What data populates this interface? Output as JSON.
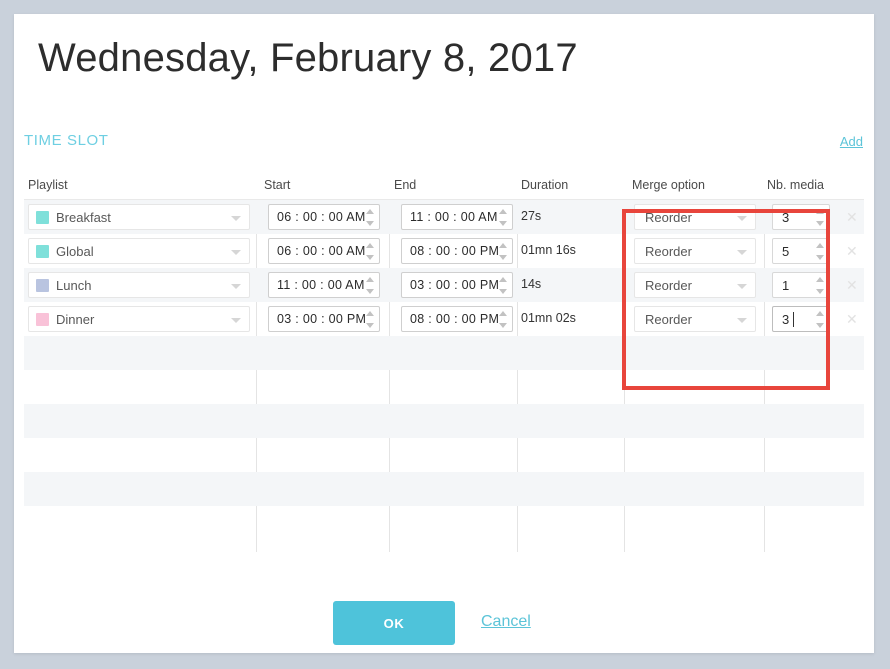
{
  "window": {
    "title": "Wednesday, February 8, 2017"
  },
  "section": {
    "title": "TIME SLOT",
    "add_label": "Add"
  },
  "table": {
    "columns": [
      {
        "key": "playlist",
        "label": "Playlist"
      },
      {
        "key": "start",
        "label": "Start"
      },
      {
        "key": "end",
        "label": "End"
      },
      {
        "key": "duration",
        "label": "Duration"
      },
      {
        "key": "merge_option",
        "label": "Merge option"
      },
      {
        "key": "nb_media",
        "label": "Nb. media"
      }
    ],
    "rows": [
      {
        "playlist": "Breakfast",
        "playlist_color": "#7fe0da",
        "start": "06 : 00 : 00 AM",
        "end": "11 : 00 : 00 AM",
        "duration": "27s",
        "merge_option": "Reorder",
        "nb_media": "3",
        "remove_icon": "close-icon"
      },
      {
        "playlist": "Global",
        "playlist_color": "#7fe0da",
        "start": "06 : 00 : 00 AM",
        "end": "08 : 00 : 00 PM",
        "duration": "01mn 16s",
        "merge_option": "Reorder",
        "nb_media": "5",
        "remove_icon": "close-icon"
      },
      {
        "playlist": "Lunch",
        "playlist_color": "#b9c4e0",
        "start": "11 : 00 : 00 AM",
        "end": "03 : 00 : 00 PM",
        "duration": "14s",
        "merge_option": "Reorder",
        "nb_media": "1",
        "remove_icon": "close-icon"
      },
      {
        "playlist": "Dinner",
        "playlist_color": "#f9c2d8",
        "start": "03 : 00 : 00 PM",
        "end": "08 : 00 : 00 PM",
        "duration": "01mn 02s",
        "merge_option": "Reorder",
        "nb_media": "3",
        "remove_icon": "close-icon",
        "focused": true
      }
    ],
    "empty_row_count": 6
  },
  "highlight": {
    "color": "#e8453c",
    "covers": "Merge option and Nb. media columns"
  },
  "footer": {
    "ok_label": "OK",
    "cancel_label": "Cancel"
  },
  "colors": {
    "accent": "#4ec3da",
    "link": "#5cc4d8",
    "section_title": "#6ecfe2",
    "page_background": "#c9d1db",
    "card_background": "#ffffff",
    "row_stripe": "#f4f6f8"
  }
}
